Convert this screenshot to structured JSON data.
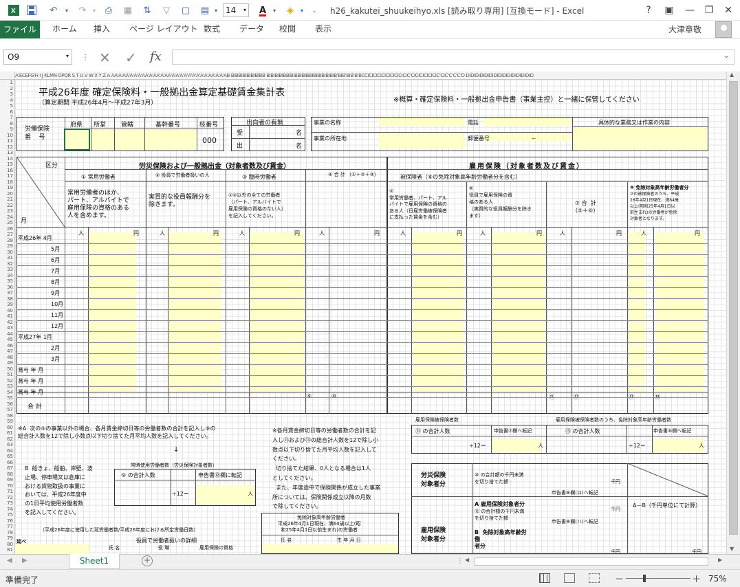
{
  "title_bar": {
    "doc_title": "h26_kakutei_shuukeihyo.xls  [読み取り専用]  [互換モード] - Excel",
    "font_size": "14",
    "help": "?",
    "min": "—",
    "restore": "❐",
    "close": "✕"
  },
  "tabs": {
    "file": "ファイル",
    "home": "ホーム",
    "insert": "挿入",
    "page_layout": "ページ レイアウト",
    "formulas": "数式",
    "data": "データ",
    "review": "校閲",
    "view": "表示",
    "user": "大津章敬"
  },
  "formula_bar": {
    "name_box": "O9",
    "cancel": "✕",
    "enter": "✓",
    "fx": "fx",
    "value": ""
  },
  "columns": "A'ECEFG'H I J KLMN OPQR S T U V W X Y Z A AA'A'AA'A'A'A'AA'A'AA'A'AA'A'A'A'A'A'A'A'A'A'AA'A'A'AB BIBBIBIBIBIBIBB BIBIBIBIBBIBIBBIBIBBIBIBIBIBIBIB'BIB'BIB'B'BCCICICICICICICICICICIC'CICICICICICIC'CIC'C'C'C'D DIDIDIDIDIDIDIDIDIDIDIDIDIDID",
  "rows": [
    "1",
    "2",
    "3",
    "4",
    "5",
    "6",
    "7",
    "8",
    "9",
    "10",
    "11",
    "12",
    "13",
    "14",
    "15",
    "16",
    "17",
    "18",
    "19",
    "20",
    "21",
    "22",
    "23",
    "24",
    "25",
    "26",
    "27",
    "28",
    "29",
    "30",
    "31",
    "32",
    "33",
    "34",
    "35",
    "36",
    "37",
    "38",
    "39",
    "40",
    "41",
    "42",
    "43",
    "44",
    "45",
    "46",
    "47",
    "48",
    "49",
    "50",
    "51",
    "52",
    "53",
    "54",
    "55",
    "56",
    "57",
    "58",
    "59",
    "60",
    "61",
    "62",
    "63",
    "64",
    "65",
    "66",
    "67",
    "68",
    "69",
    "70",
    "71",
    "72",
    "73",
    "74",
    "75",
    "76",
    "77",
    "78",
    "79",
    "80",
    "81"
  ],
  "sheet": {
    "title": "平成26年度  確定保険料・一般拠出金算定基礎賃金集計表",
    "period": "（算定期間  平成26年4月～平成27年3月）",
    "note_top": "※概算・確定保険料・一般拠出金申告書（事業主控）と一緒に保管してください",
    "labor_no_label": "労働保険\n番    号",
    "hdr_pref": "府県",
    "hdr_office": "所掌",
    "hdr_jurisdiction": "管轄",
    "hdr_base": "基幹番号",
    "hdr_branch": "枝番号",
    "branch_value": "000",
    "dispatch_title": "出向者の有無",
    "dispatch_in": "受",
    "dispatch_out": "出",
    "dispatch_name": "名",
    "biz_name": "事業の名称",
    "biz_addr": "事業の所在地",
    "tel": "電話",
    "postal": "郵便番号",
    "postal_dash": "－",
    "biz_detail": "具体的な業務又は作業の内容",
    "cat_label": "区分",
    "month_label": "月",
    "section_rousai": "労災保険および一般拠出金（対象者数及び賃金）",
    "section_koyou": "雇用保険（対象者数及び賃金）",
    "col1": "①  常用労働者",
    "col2": "②  役員で労働者扱いの人",
    "col3": "③  臨時労働者",
    "col4": "④  合  計 （①＋②＋③）",
    "col5_head": "被保険者（⑧の免除対象高年齢労働者分を含む）",
    "col7": "⑦ 合  計\n（⑤＋⑥）",
    "col8": "⑧ 免除対象高年齢労働者分",
    "desc1": "常用労働者のほか、\nパート、アルバイトで\n雇用保険の資格のある\n人を含めます。",
    "desc2": "実質的な役員報酬分を\n除きます。",
    "desc3": "①②以外の全ての労働者\n（パート、アルバイトで\n雇用保険の資格のない人）\nを記入してください。",
    "desc5": "⑤\n常用労働者、パート、アル\nバイトで雇用保険の資格の\nある人（日雇労働被保険者\nに支払った賃金を含む）",
    "desc6": "⑥\n役員で雇用保険の資\n格のある人\n（実質的な役員報酬分を除き\nます）",
    "desc8": "⑦の被保険者のうち、平成\n26年4月1日現在、満64歳\n以上(昭和25年4月1日以\n前生まれ)の労働者が免除\n対象者となります。",
    "unit_person": "人",
    "unit_yen": "円",
    "months": [
      "平成26年  4月",
      "5月",
      "6月",
      "7月",
      "8月",
      "9月",
      "10月",
      "11月",
      "12月",
      "平成27年  1月",
      "2月",
      "3月",
      "賞与    年    月",
      "賞与    年    月",
      "賞与    年    月"
    ],
    "total_label": "合    計",
    "circ9": "⑨",
    "circ10": "⑩",
    "circ11": "⑪",
    "circ12": "⑫",
    "circ13": "⑬",
    "circ14": "⑭",
    "note_a": "※A  次の⑤の事業以外の場合、各月賃金締切日等の労働者数の合計を記入し⑨の\n総合計人数を12で除し小数点以下切り捨てた月平均人数を記入してください。",
    "arrow_down": "↓",
    "note_b": "B  船きょ、船舶、岸壁、波\n止場、停車場又は倉庫に\nおける貨物取扱の事業に\nおいては、平成26年度中\nの1日平均使用労働者数\nを記入してください。",
    "regular_title": "常時使用労働者数（労災保険対象者数）",
    "reg_total": "⑨ の合計人数",
    "reg_div": "÷12＝",
    "reg_transfer": "申告書⑫欄に転記",
    "note_c": "※各月賃金締切日等の労働者数の合計を記\n入し⑪および⑬の総合計人数を12で除し小\n数点以下切り捨てた月平均人数を記入して\nください。\n  切り捨てた結果、0人となる場合は1人\nとしてください。\n  また、年度途中で保険関係が成立した事業\n所については、保険関係成立以降の月数\nで除してください。",
    "emp_ins_title": "雇用保険被保険者数",
    "emp_ins_exempt": "雇用保険被保険者数のうち、免除対象高年齢労働者数",
    "c11_total": "⑪ の合計人数",
    "c11_transfer": "申告書⑦欄へ転記",
    "c13_total": "⑬ の合計人数",
    "c13_transfer": "申告書⑥欄へ転記",
    "div12": "÷12＝",
    "rousai_label": "労災保険\n対象者分",
    "r10_text": "⑩ の合計額の千円未満\nを切り捨てた額",
    "thousand": "千円",
    "r_transfer": "申告書⑧欄(ロ)へ転記",
    "koyou_label": "雇用保険\n対象者分",
    "koyou_a": "A  雇用保険対象者分",
    "koyou_a_text": "⑫ の合計額の千円未満\nを切り捨てた額",
    "koyou_transfer": "申告書⑧欄(ハ)へ転記",
    "koyou_b": "B  免除対象高年齢労\n働\n者分",
    "a_minus_b": "A－B（千円単位にて計算）",
    "exempt_box_title": "免除対象高年齢労働者",
    "exempt_box_sub": "平成26年4月1日現在、満64歳以上(昭\n和25年4月1日以前生まれ)の労働者",
    "exempt_name": "氏  名",
    "exempt_birth": "生  年  月  日",
    "prev_year": "（平成26年度に使用した延労働者数/平成26年度における所定労働日数）",
    "officer_title": "役員で労働者扱いの詳細",
    "officer_name": "氏  名",
    "officer_position": "役  職",
    "officer_qual": "雇用保険の資格",
    "r81_label": "延べ"
  },
  "sheet_tab": "Sheet1",
  "status": {
    "ready": "準備完了",
    "zoom": "75%",
    "minus": "－",
    "plus": "＋"
  }
}
